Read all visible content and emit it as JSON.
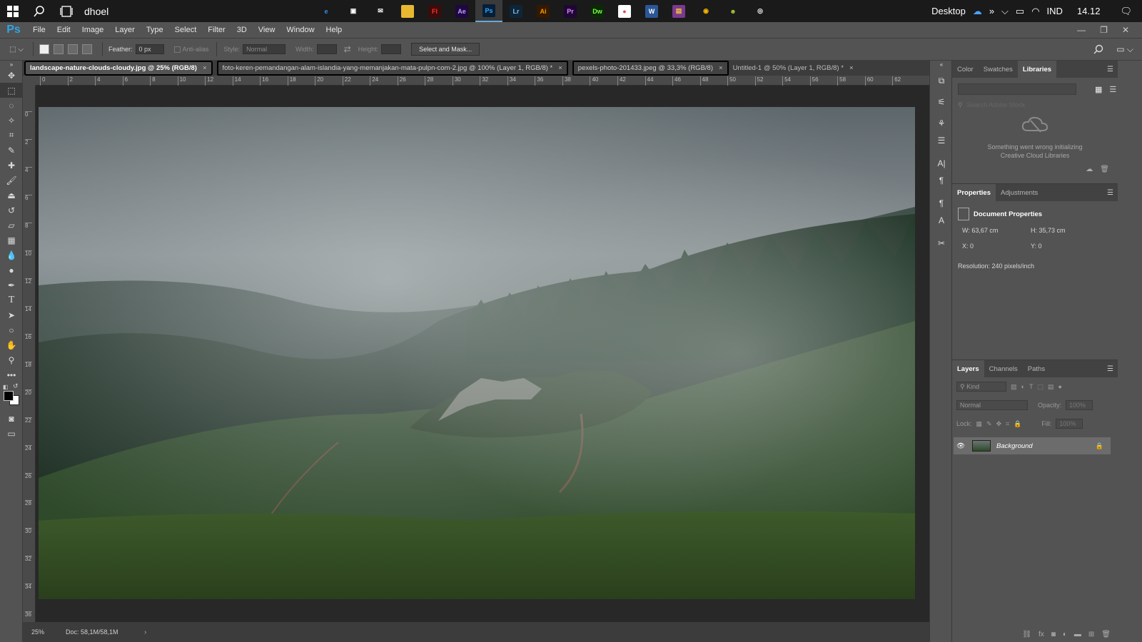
{
  "taskbar": {
    "user": "dhoel",
    "apps": [
      {
        "icon": "edge-icon",
        "label": "e",
        "bg": "#1a1a1a",
        "fg": "#2f8ee0"
      },
      {
        "icon": "store-icon",
        "label": "▣",
        "bg": "#1a1a1a",
        "fg": "#ffffff"
      },
      {
        "icon": "mail-icon",
        "label": "✉",
        "bg": "#1a1a1a",
        "fg": "#ffffff"
      },
      {
        "icon": "file-explorer-icon",
        "label": "▬",
        "bg": "#e8b730",
        "fg": "#e8b730"
      },
      {
        "icon": "flash-icon",
        "label": "Fl",
        "bg": "#3d0b0b",
        "fg": "#ff3030"
      },
      {
        "icon": "after-effects-icon",
        "label": "Ae",
        "bg": "#1f0740",
        "fg": "#b7a0ff"
      },
      {
        "icon": "photoshop-icon",
        "label": "Ps",
        "bg": "#061e36",
        "fg": "#31a8ff"
      },
      {
        "icon": "lightroom-icon",
        "label": "Lr",
        "bg": "#0e2538",
        "fg": "#7fbbe6"
      },
      {
        "icon": "illustrator-icon",
        "label": "Ai",
        "bg": "#331900",
        "fg": "#ff9a00"
      },
      {
        "icon": "premiere-icon",
        "label": "Pr",
        "bg": "#1f0735",
        "fg": "#e28bff"
      },
      {
        "icon": "dreamweaver-icon",
        "label": "Dw",
        "bg": "#0a2a05",
        "fg": "#7dff4a"
      },
      {
        "icon": "paint-icon",
        "label": "●",
        "bg": "#ffffff",
        "fg": "#e24a4a"
      },
      {
        "icon": "word-icon",
        "label": "W",
        "bg": "#2b5797",
        "fg": "#ffffff"
      },
      {
        "icon": "winrar-icon",
        "label": "▤",
        "bg": "#7a3a8c",
        "fg": "#f0c040"
      },
      {
        "icon": "chrome-icon",
        "label": "◉",
        "bg": "#1a1a1a",
        "fg": "#f2b600"
      },
      {
        "icon": "android-icon",
        "label": "☻",
        "bg": "#1a1a1a",
        "fg": "#a4c639"
      },
      {
        "icon": "disc-icon",
        "label": "◎",
        "bg": "#1a1a1a",
        "fg": "#ffffff"
      }
    ],
    "active_app_index": 6,
    "desktop_label": "Desktop",
    "language": "IND",
    "time": "14.12"
  },
  "menubar": {
    "logo": "Ps",
    "items": [
      "File",
      "Edit",
      "Image",
      "Layer",
      "Type",
      "Select",
      "Filter",
      "3D",
      "View",
      "Window",
      "Help"
    ]
  },
  "options": {
    "feather_label": "Feather:",
    "feather_value": "0 px",
    "antialias_label": "Anti-alias",
    "style_label": "Style:",
    "style_value": "Normal",
    "width_label": "Width:",
    "height_label": "Height:",
    "select_mask_label": "Select and Mask..."
  },
  "tabs": [
    {
      "label": "landscape-nature-clouds-cloudy.jpg @ 25% (RGB/8)",
      "active": true
    },
    {
      "label": "foto-keren-pemandangan-alam-islandia-yang-memanjakan-mata-pulpn-com-2.jpg @ 100% (Layer 1, RGB/8) *",
      "active": false,
      "circled": true
    },
    {
      "label": "pexels-photo-201433.jpeg @ 33,3% (RGB/8)",
      "active": false,
      "circled": true
    },
    {
      "label": "Untitled-1 @ 50% (Layer 1, RGB/8) *",
      "active": false,
      "circled": false
    }
  ],
  "ruler": {
    "top_labels": [
      "0",
      "2",
      "4",
      "6",
      "8",
      "10",
      "12",
      "14",
      "16",
      "18",
      "20",
      "22",
      "24",
      "26",
      "28",
      "30",
      "32",
      "34",
      "36",
      "38",
      "40",
      "42",
      "44",
      "46",
      "48",
      "50",
      "52",
      "54",
      "56",
      "58",
      "60",
      "62"
    ],
    "left_labels": [
      "0",
      "2",
      "4",
      "6",
      "8",
      "10",
      "12",
      "14",
      "16",
      "18",
      "20",
      "22",
      "24",
      "26",
      "28",
      "30",
      "32",
      "34",
      "36"
    ]
  },
  "status": {
    "zoom": "25%",
    "doc": "Doc: 58,1M/58,1M"
  },
  "libraries_panel": {
    "tabs": [
      "Color",
      "Swatches",
      "Libraries"
    ],
    "active_tab": "Libraries",
    "search_placeholder": "Search Adobe Stock",
    "error_line1": "Something went wrong initializing",
    "error_line2": "Creative Cloud Libraries"
  },
  "properties_panel": {
    "tabs": [
      "Properties",
      "Adjustments"
    ],
    "active_tab": "Properties",
    "title": "Document Properties",
    "w_label": "W:",
    "w_value": "63,67 cm",
    "h_label": "H:",
    "h_value": "35,73 cm",
    "x_label": "X:",
    "x_value": "0",
    "y_label": "Y:",
    "y_value": "0",
    "resolution": "Resolution: 240 pixels/inch"
  },
  "layers_panel": {
    "tabs": [
      "Layers",
      "Channels",
      "Paths"
    ],
    "active_tab": "Layers",
    "kind_label": "Kind",
    "blend_mode": "Normal",
    "opacity_label": "Opacity:",
    "opacity_value": "100%",
    "lock_label": "Lock:",
    "fill_label": "Fill:",
    "fill_value": "100%",
    "layer_name": "Background"
  }
}
